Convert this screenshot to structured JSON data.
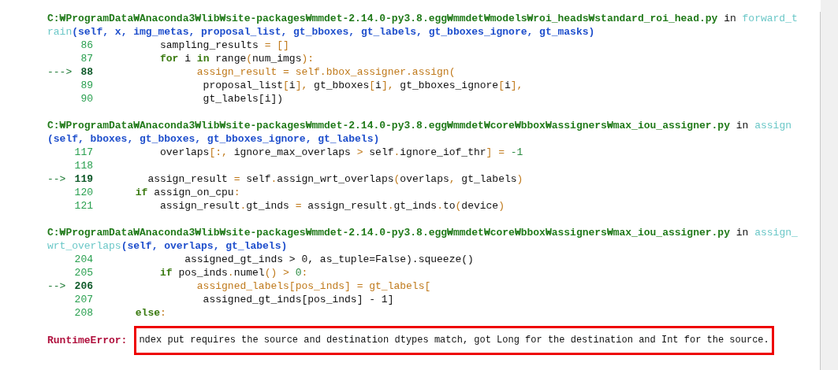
{
  "frames": [
    {
      "path": "C:₩ProgramData₩Anaconda3₩lib₩site-packages₩mmdet-2.14.0-py3.8.egg₩mmdet₩models₩roi_heads₩standard_roi_head.py",
      "in": "in",
      "function": "forward_t",
      "function_continued": "rain",
      "signature": "(self, x, img_metas, proposal_list, gt_bboxes, gt_labels, gt_bboxes_ignore, gt_masks)",
      "lines": [
        {
          "number": "86",
          "current": false,
          "code": [
            {
              "text": "          sampling_results ",
              "kind": "plain"
            },
            {
              "text": "= []",
              "kind": "op"
            }
          ]
        },
        {
          "number": "87",
          "current": false,
          "code": [
            {
              "text": "          for",
              "kind": "keyword"
            },
            {
              "text": " i ",
              "kind": "plain"
            },
            {
              "text": "in",
              "kind": "keyword"
            },
            {
              "text": " range",
              "kind": "plain"
            },
            {
              "text": "(",
              "kind": "op"
            },
            {
              "text": "num_imgs",
              "kind": "plain"
            },
            {
              "text": "):",
              "kind": "op"
            }
          ]
        },
        {
          "number": "88",
          "marker": "--->",
          "current": true,
          "code": [
            {
              "text": "                assign_result = self.bbox_assigner.assign(",
              "kind": "op"
            }
          ]
        },
        {
          "number": "89",
          "current": false,
          "code": [
            {
              "text": "                 proposal_list",
              "kind": "plain"
            },
            {
              "text": "[",
              "kind": "op"
            },
            {
              "text": "i",
              "kind": "plain"
            },
            {
              "text": "],",
              "kind": "op"
            },
            {
              "text": " gt_bboxes",
              "kind": "plain"
            },
            {
              "text": "[",
              "kind": "op"
            },
            {
              "text": "i",
              "kind": "plain"
            },
            {
              "text": "],",
              "kind": "op"
            },
            {
              "text": " gt_bboxes_ignore",
              "kind": "plain"
            },
            {
              "text": "[",
              "kind": "op"
            },
            {
              "text": "i",
              "kind": "plain"
            },
            {
              "text": "],",
              "kind": "op"
            }
          ]
        },
        {
          "number": "90",
          "current": false,
          "code": [
            {
              "text": "                 gt_labels[i])",
              "kind": "plain"
            }
          ]
        }
      ]
    },
    {
      "path": "C:₩ProgramData₩Anaconda3₩lib₩site-packages₩mmdet-2.14.0-py3.8.egg₩mmdet₩core₩bbox₩assigners₩max_iou_assigner.py",
      "in": "in",
      "function": "assign",
      "signature": "(self, bboxes, gt_bboxes, gt_bboxes_ignore, gt_labels)",
      "lines": [
        {
          "number": "117",
          "current": false,
          "code": [
            {
              "text": "          overlaps",
              "kind": "plain"
            },
            {
              "text": "[:,",
              "kind": "op"
            },
            {
              "text": " ignore_max_overlaps ",
              "kind": "plain"
            },
            {
              "text": ">",
              "kind": "op"
            },
            {
              "text": " self",
              "kind": "plain"
            },
            {
              "text": ".",
              "kind": "op"
            },
            {
              "text": "ignore_iof_thr",
              "kind": "plain"
            },
            {
              "text": "] = ",
              "kind": "op"
            },
            {
              "text": "-1",
              "kind": "number"
            }
          ]
        },
        {
          "number": "118",
          "current": false
        },
        {
          "number": "119",
          "marker": "-->",
          "current": true,
          "code": [
            {
              "text": "        assign_result ",
              "kind": "plain"
            },
            {
              "text": "=",
              "kind": "op"
            },
            {
              "text": " self",
              "kind": "plain"
            },
            {
              "text": ".",
              "kind": "op"
            },
            {
              "text": "assign_wrt_overlaps",
              "kind": "plain"
            },
            {
              "text": "(",
              "kind": "op"
            },
            {
              "text": "overlaps",
              "kind": "plain"
            },
            {
              "text": ",",
              "kind": "op"
            },
            {
              "text": " gt_labels",
              "kind": "plain"
            },
            {
              "text": ")",
              "kind": "op"
            }
          ]
        },
        {
          "number": "120",
          "current": false,
          "code": [
            {
              "text": "      if",
              "kind": "keyword"
            },
            {
              "text": " assign_on_cpu",
              "kind": "plain"
            },
            {
              "text": ":",
              "kind": "op"
            }
          ]
        },
        {
          "number": "121",
          "current": false,
          "code": [
            {
              "text": "          assign_result",
              "kind": "plain"
            },
            {
              "text": ".",
              "kind": "op"
            },
            {
              "text": "gt_inds ",
              "kind": "plain"
            },
            {
              "text": "=",
              "kind": "op"
            },
            {
              "text": " assign_result",
              "kind": "plain"
            },
            {
              "text": ".",
              "kind": "op"
            },
            {
              "text": "gt_inds",
              "kind": "plain"
            },
            {
              "text": ".",
              "kind": "op"
            },
            {
              "text": "to",
              "kind": "plain"
            },
            {
              "text": "(",
              "kind": "op"
            },
            {
              "text": "device",
              "kind": "plain"
            },
            {
              "text": ")",
              "kind": "op"
            }
          ]
        }
      ]
    },
    {
      "path": "C:₩ProgramData₩Anaconda3₩lib₩site-packages₩mmdet-2.14.0-py3.8.egg₩mmdet₩core₩bbox₩assigners₩max_iou_assigner.py",
      "in": "in",
      "function": "assign_",
      "function_continued": "wrt_overlaps",
      "signature": "(self, overlaps, gt_labels)",
      "lines": [
        {
          "number": "204",
          "current": false,
          "code": [
            {
              "text": "              assigned_gt_inds > 0, as_tuple=False).squeeze()",
              "kind": "plain"
            }
          ]
        },
        {
          "number": "205",
          "current": false,
          "code": [
            {
              "text": "          if",
              "kind": "keyword"
            },
            {
              "text": " pos_inds",
              "kind": "plain"
            },
            {
              "text": ".",
              "kind": "op"
            },
            {
              "text": "numel",
              "kind": "plain"
            },
            {
              "text": "() > ",
              "kind": "op"
            },
            {
              "text": "0",
              "kind": "number"
            },
            {
              "text": ":",
              "kind": "op"
            }
          ]
        },
        {
          "number": "206",
          "marker": "-->",
          "current": true,
          "code": [
            {
              "text": "                assigned_labels[pos_inds] = gt_labels[",
              "kind": "op"
            }
          ]
        },
        {
          "number": "207",
          "current": false,
          "code": [
            {
              "text": "                 assigned_gt_inds[pos_inds] - 1]",
              "kind": "plain"
            }
          ]
        },
        {
          "number": "208",
          "current": false,
          "code": [
            {
              "text": "      else",
              "kind": "keyword"
            },
            {
              "text": ":",
              "kind": "op"
            }
          ]
        }
      ]
    }
  ],
  "error": {
    "type": "RuntimeError:",
    "message": "ndex put requires the source and destination dtypes match, got Long for the destination and Int for the source."
  }
}
